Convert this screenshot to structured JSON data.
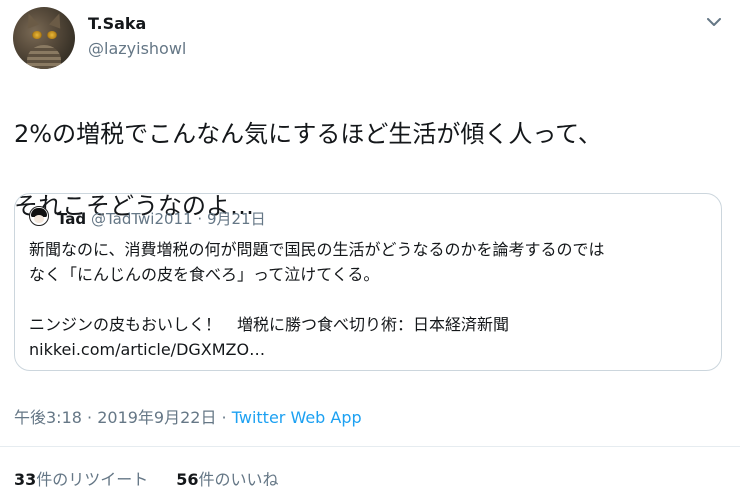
{
  "author": {
    "name": "T.Saka",
    "handle": "@lazyishowl"
  },
  "tweet": {
    "text_line1": "2%の増税でこんなん気にするほど生活が傾く人って、",
    "text_line2": "それこそどうなのよ…"
  },
  "quoted": {
    "name": "Tad",
    "handle": "@TadTwi2011",
    "separator": " · ",
    "date": "9月21日",
    "line1": "新聞なのに、消費増税の何が問題で国民の生活がどうなるのかを論考するのでは",
    "line2": "なく「にんじんの皮を食べろ」って泣けてくる。",
    "line3": "ニンジンの皮もおいしく！　増税に勝つ食べ切り術：日本経済新聞",
    "line4": "nikkei.com/article/DGXMZO…"
  },
  "meta": {
    "time": "午後3:18",
    "separator": " · ",
    "date": "2019年9月22日",
    "separator2": " · ",
    "app": "Twitter Web App"
  },
  "stats": {
    "retweet_count": "33",
    "retweet_label": "件のリツイート",
    "like_count": "56",
    "like_label": "件のいいね"
  },
  "icons": {
    "caret": "chevron-down-icon"
  },
  "colors": {
    "link": "#1da1f2",
    "secondary_text": "#657786",
    "border": "#ccd6dd"
  }
}
